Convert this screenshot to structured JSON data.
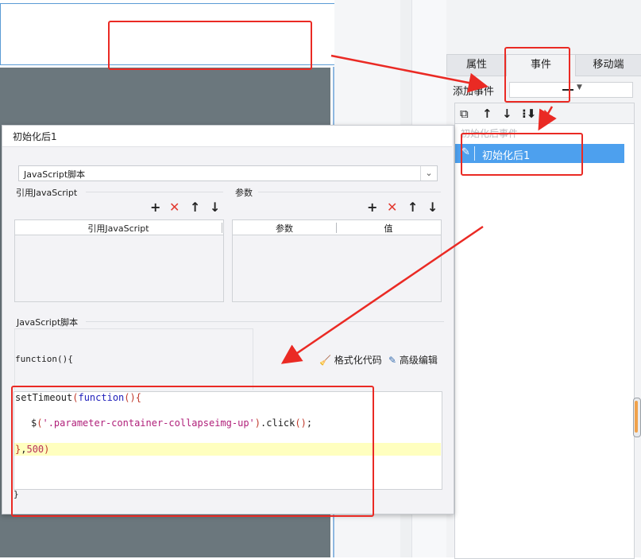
{
  "right_panel": {
    "tabs": [
      {
        "label": "属性",
        "active": false
      },
      {
        "label": "事件",
        "active": true
      },
      {
        "label": "移动端",
        "active": false
      }
    ],
    "add_event": {
      "label": "添加事件",
      "value": ""
    },
    "toolbar_icons": [
      "copy-icon",
      "arrow-up-icon",
      "arrow-down-icon",
      "reorder-icon",
      "delete-icon"
    ],
    "event_group_label": "初始化后事件",
    "event_item": {
      "label": "初始化后1",
      "icon": "pencil-icon",
      "selected": true
    }
  },
  "dialog": {
    "title": "初始化后1",
    "type_select": {
      "value": "JavaScript脚本"
    },
    "ref_js": {
      "section_label": "引用JavaScript",
      "column_header": "引用JavaScript",
      "actions": [
        "add-icon",
        "delete-icon",
        "move-up-icon",
        "move-down-icon"
      ],
      "rows": []
    },
    "params": {
      "section_label": "参数",
      "columns": [
        "参数",
        "值"
      ],
      "actions": [
        "add-icon",
        "delete-icon",
        "move-up-icon",
        "move-down-icon"
      ],
      "rows": []
    },
    "script_section_label": "JavaScript脚本",
    "function_header": "function(){",
    "function_footer": "}",
    "format_button": "格式化代码",
    "advanced_button": "高级编辑",
    "code": {
      "kw_settimeout": "setTimeout",
      "kw_function": "function",
      "selector_string": "'.parameter-container-collapseimg-up'",
      "method_click": ".click",
      "timeout_value": "500"
    }
  },
  "colors": {
    "selection_blue": "#4da0ee",
    "annotation_red": "#ea2a24",
    "canvas_dark": "#6b777d",
    "highlight_line": "#ffffbf"
  }
}
